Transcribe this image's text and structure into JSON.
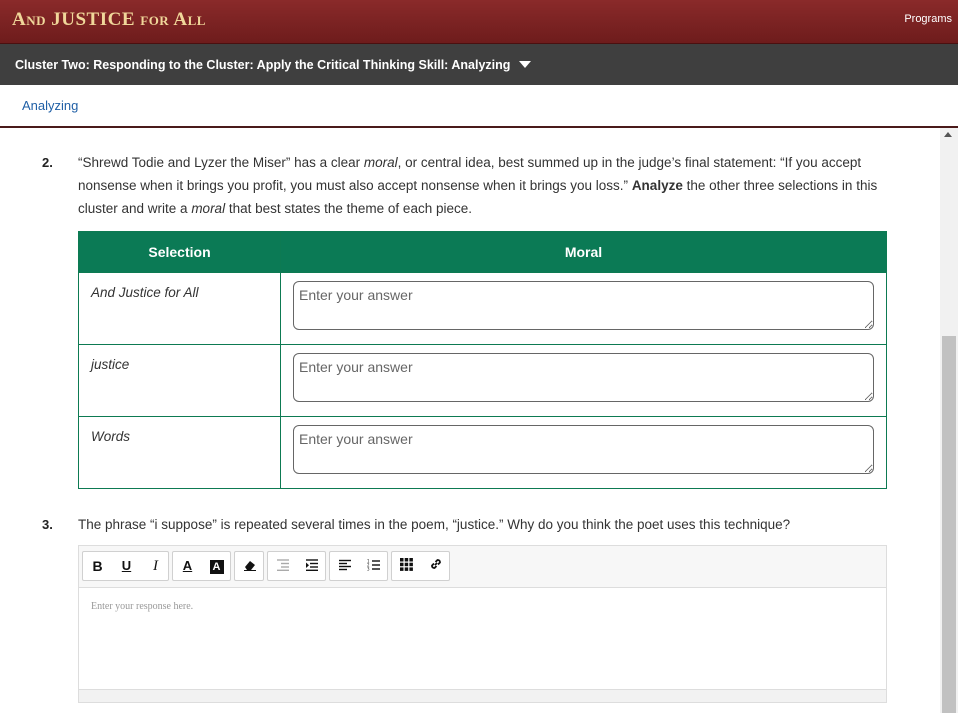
{
  "app": {
    "brand": "And JUSTICE for All",
    "programs_label": "Programs"
  },
  "cluster": {
    "title": "Cluster Two: Responding to the Cluster: Apply the Critical Thinking Skill: Analyzing"
  },
  "subnav": {
    "tab": "Analyzing"
  },
  "q2": {
    "number": "2.",
    "text_part1": "“Shrewd Todie and Lyzer the Miser” has a clear ",
    "moral_word": "moral",
    "text_part2": ", or central idea, best summed up in the judge’s final statement: “If you accept nonsense when it brings you profit, you must also accept nonsense when it brings you loss.” ",
    "analyze_word": "Analyze",
    "text_part3": " the other three selections in this cluster and write a ",
    "moral_word2": "moral",
    "text_part4": " that best states the theme of each piece.",
    "table": {
      "col_selection": "Selection",
      "col_moral": "Moral",
      "rows": [
        {
          "selection": "And Justice for All",
          "placeholder": "Enter your answer",
          "value": ""
        },
        {
          "selection": "justice",
          "placeholder": "Enter your answer",
          "value": ""
        },
        {
          "selection": "Words",
          "placeholder": "Enter your answer",
          "value": ""
        }
      ]
    }
  },
  "q3": {
    "number": "3.",
    "text": "The phrase “i suppose” is repeated several times in the poem, “justice.” Why do you think the poet uses this technique?",
    "editor_placeholder": "Enter your response here.",
    "toolbar": {
      "bold": "B",
      "underline": "U",
      "italic": "I",
      "font_color": "A",
      "bg_color": "A",
      "clear_format_icon": "eraser-icon",
      "outdent_icon": "outdent-icon",
      "indent_icon": "indent-icon",
      "align_icon": "align-left-icon",
      "ordered_list_icon": "ordered-list-icon",
      "table_icon": "table-grid-icon",
      "link_icon": "link-icon"
    }
  }
}
